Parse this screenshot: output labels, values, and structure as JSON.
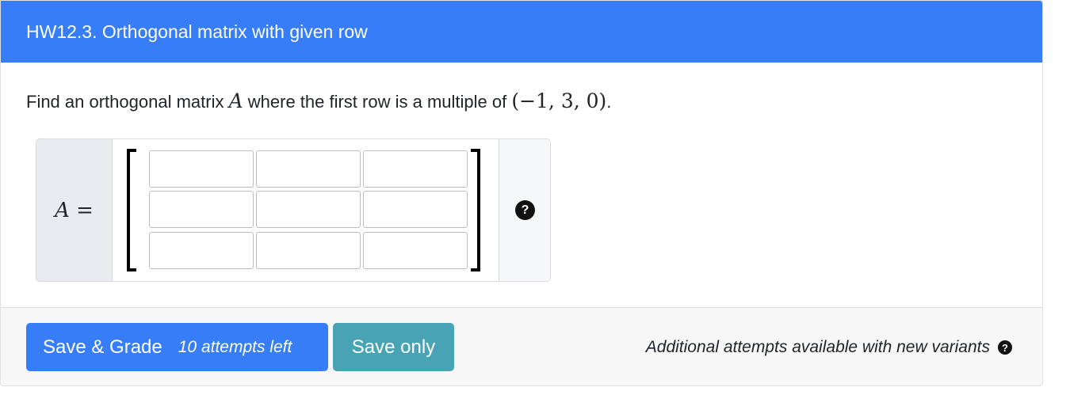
{
  "header": {
    "title": "HW12.3. Orthogonal matrix with given row"
  },
  "question": {
    "prefix": "Find an orthogonal matrix ",
    "var": "A",
    "middle": " where the first row is a multiple of ",
    "vector": "(−1, 3, 0)",
    "suffix": "."
  },
  "matrix_input": {
    "label_var": "A",
    "label_eq": " =",
    "cells": [
      [
        "",
        "",
        ""
      ],
      [
        "",
        "",
        ""
      ],
      [
        "",
        "",
        ""
      ]
    ],
    "help_icon": "question-circle-icon"
  },
  "footer": {
    "grade_label": "Save & Grade",
    "attempts_left": "10 attempts left",
    "save_label": "Save only",
    "note": "Additional attempts available with new variants",
    "note_icon": "question-circle-icon"
  },
  "colors": {
    "header_bg": "#377df7",
    "grade_button": "#377df7",
    "save_button": "#48a4b5",
    "footer_bg": "#f7f7f7"
  }
}
